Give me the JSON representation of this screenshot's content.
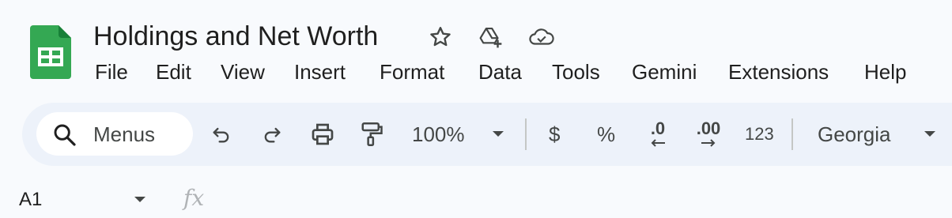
{
  "document": {
    "title": "Holdings and Net Worth"
  },
  "menu": [
    "File",
    "Edit",
    "View",
    "Insert",
    "Format",
    "Data",
    "Tools",
    "Gemini",
    "Extensions",
    "Help"
  ],
  "toolbar": {
    "search_label": "Menus",
    "zoom": "100%",
    "currency_label": "$",
    "percent_label": "%",
    "decrease_decimal_label": ".0",
    "increase_decimal_label": ".00",
    "number_format_label": "123",
    "font_family": "Georgia"
  },
  "formula_bar": {
    "name_box": "A1",
    "fx_label": "fx"
  },
  "colors": {
    "sheets_green": "#34a853",
    "toolbar_bg": "#edf2fa",
    "page_bg": "#f8fafd",
    "icon": "#444746"
  }
}
